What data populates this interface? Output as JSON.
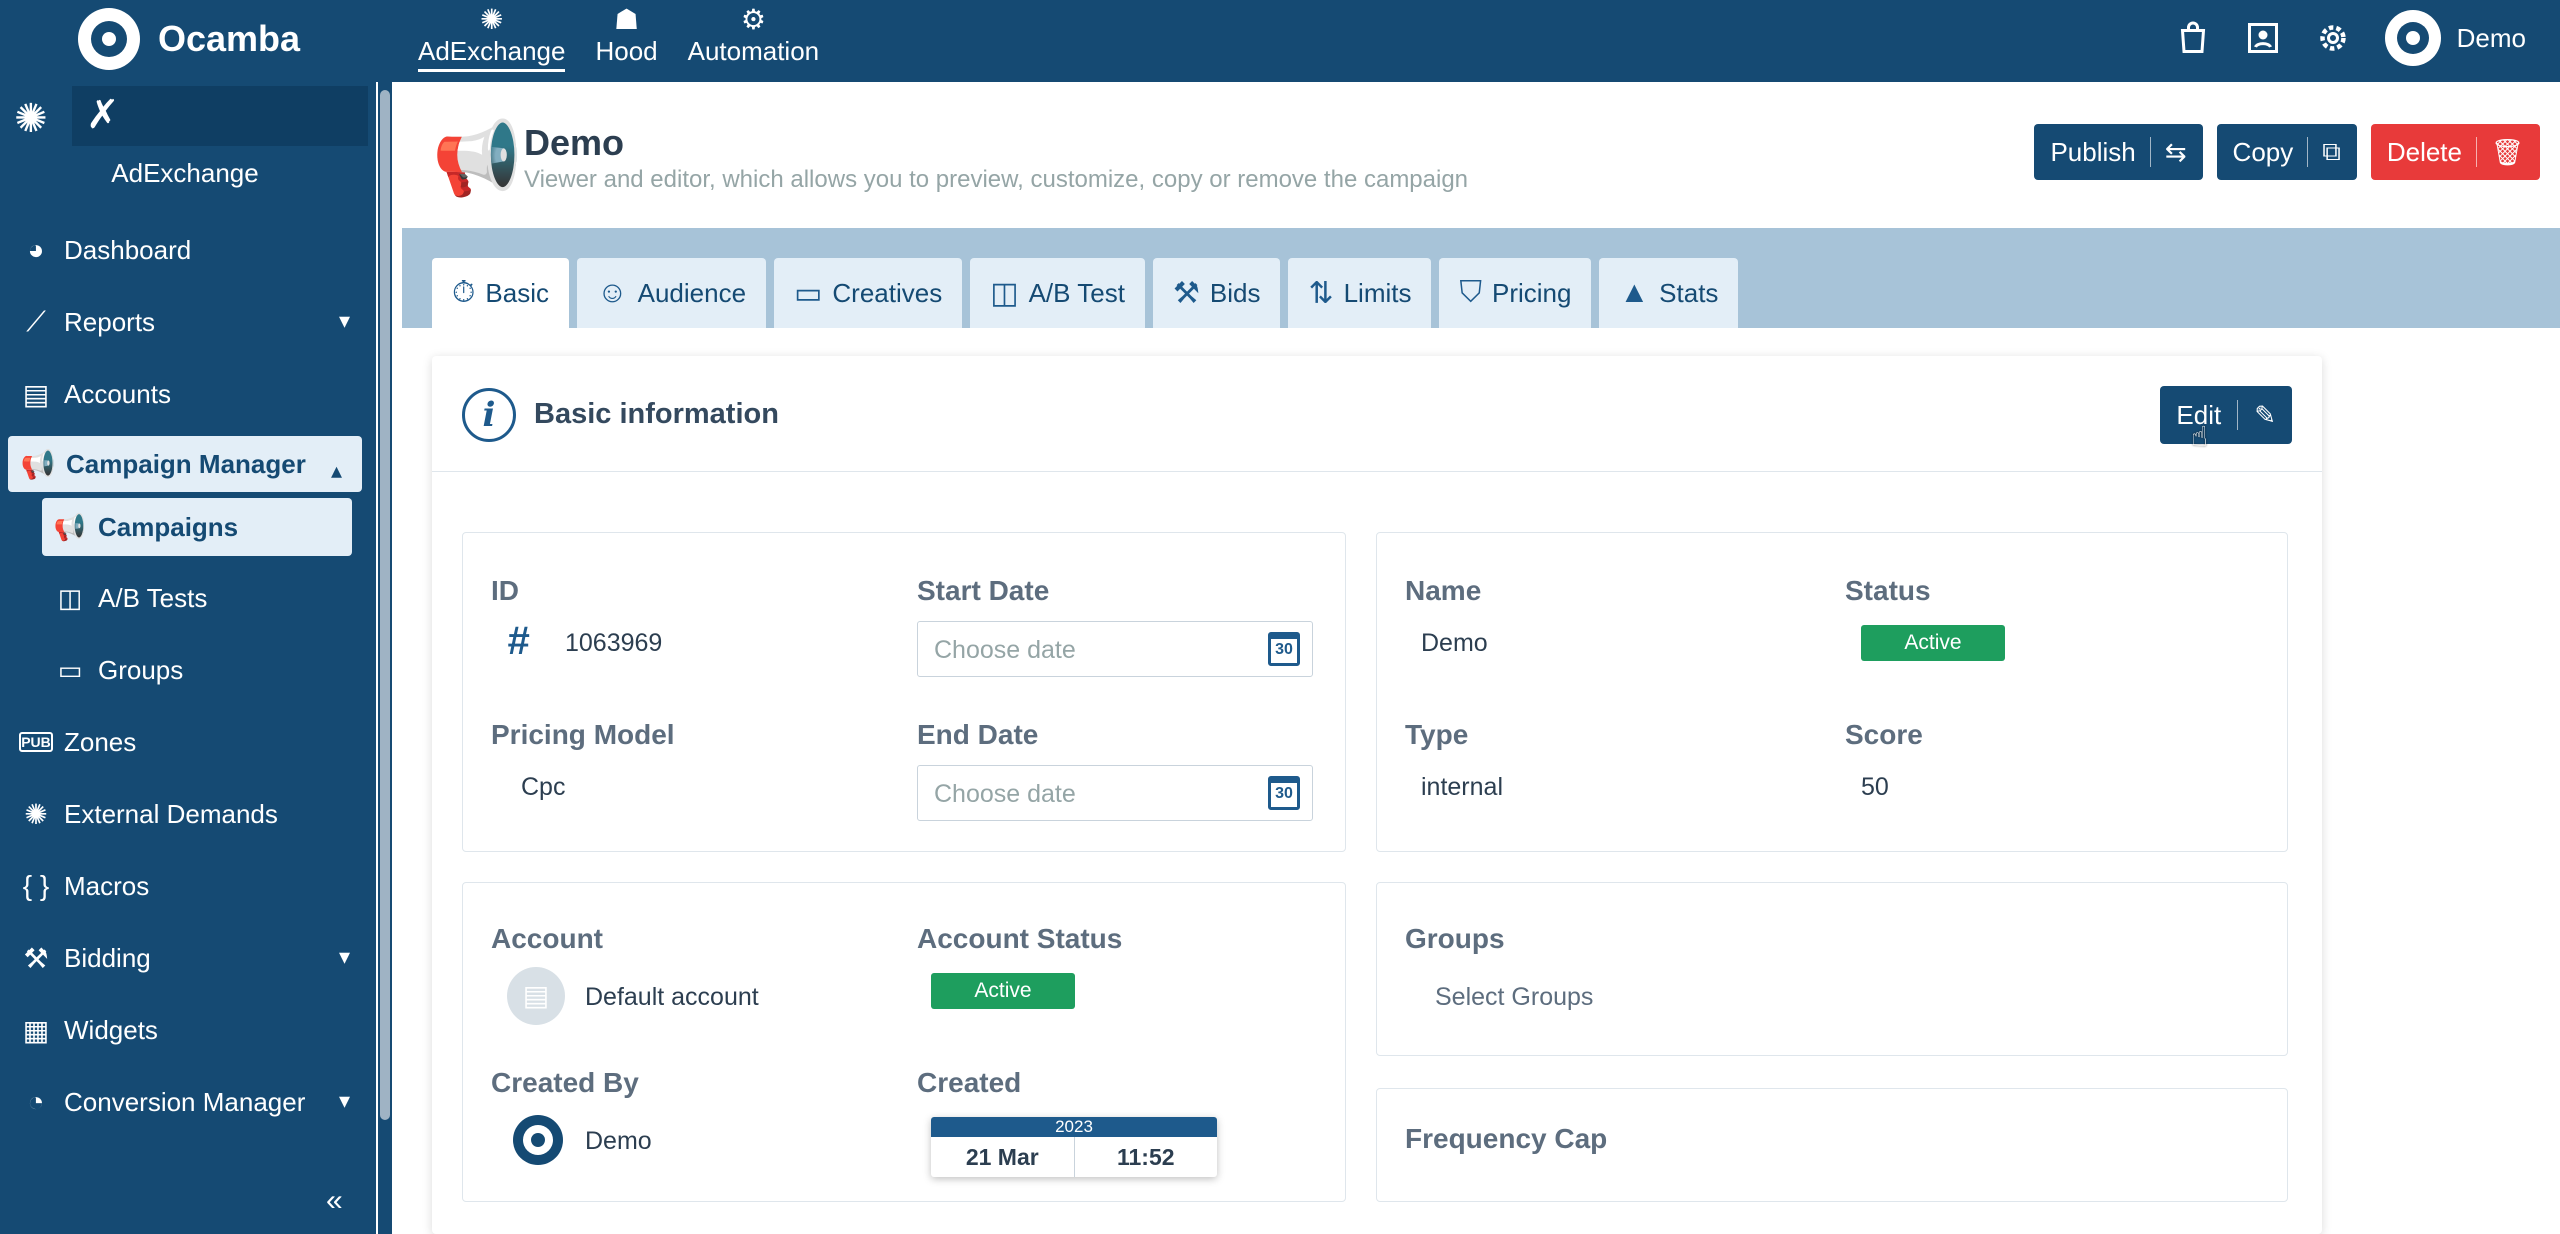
{
  "topbar": {
    "brand": "Ocamba",
    "nav": [
      {
        "label": "AdExchange",
        "icon": "sun-icon",
        "active": true
      },
      {
        "label": "Hood",
        "icon": "hood-icon",
        "active": false
      },
      {
        "label": "Automation",
        "icon": "automation-icon",
        "active": false
      }
    ],
    "user": "Demo"
  },
  "sidebar": {
    "title": "AdExchange",
    "items": [
      {
        "label": "Dashboard",
        "icon": "dashboard-icon"
      },
      {
        "label": "Reports",
        "icon": "reports-icon"
      },
      {
        "label": "Accounts",
        "icon": "accounts-icon"
      },
      {
        "label": "Campaign Manager",
        "icon": "megaphone-icon"
      },
      {
        "label": "Campaigns",
        "icon": "megaphone-icon"
      },
      {
        "label": "A/B Tests",
        "icon": "ab-icon"
      },
      {
        "label": "Groups",
        "icon": "folder-icon"
      },
      {
        "label": "Zones",
        "icon": "pub-icon"
      },
      {
        "label": "External Demands",
        "icon": "sun-icon"
      },
      {
        "label": "Macros",
        "icon": "braces-icon"
      },
      {
        "label": "Bidding",
        "icon": "gavel-icon"
      },
      {
        "label": "Widgets",
        "icon": "widgets-icon"
      },
      {
        "label": "Conversion Manager",
        "icon": "conversion-icon"
      }
    ]
  },
  "page": {
    "title": "Demo",
    "subtitle": "Viewer and editor, which allows you to preview, customize, copy or remove the campaign",
    "actions": {
      "publish": "Publish",
      "copy": "Copy",
      "delete": "Delete"
    }
  },
  "tabs": [
    "Basic",
    "Audience",
    "Creatives",
    "A/B Test",
    "Bids",
    "Limits",
    "Pricing",
    "Stats"
  ],
  "card": {
    "title": "Basic information",
    "edit": "Edit",
    "id_label": "ID",
    "id_value": "1063969",
    "start_label": "Start Date",
    "start_placeholder": "Choose date",
    "pricing_label": "Pricing Model",
    "pricing_value": "Cpc",
    "end_label": "End Date",
    "end_placeholder": "Choose date",
    "name_label": "Name",
    "name_value": "Demo",
    "status_label": "Status",
    "status_value": "Active",
    "type_label": "Type",
    "type_value": "internal",
    "score_label": "Score",
    "score_value": "50",
    "account_label": "Account",
    "account_value": "Default account",
    "account_status_label": "Account Status",
    "account_status_value": "Active",
    "created_by_label": "Created By",
    "created_by_value": "Demo",
    "created_label": "Created",
    "created_year": "2023",
    "created_date": "21 Mar",
    "created_time": "11:52",
    "groups_label": "Groups",
    "groups_placeholder": "Select Groups",
    "freq_label": "Frequency Cap",
    "calendar_day": "30"
  },
  "colors": {
    "primary": "#154a73",
    "danger": "#e83a3a",
    "success": "#1e9e5e",
    "tabbar": "#a7c3d8"
  }
}
